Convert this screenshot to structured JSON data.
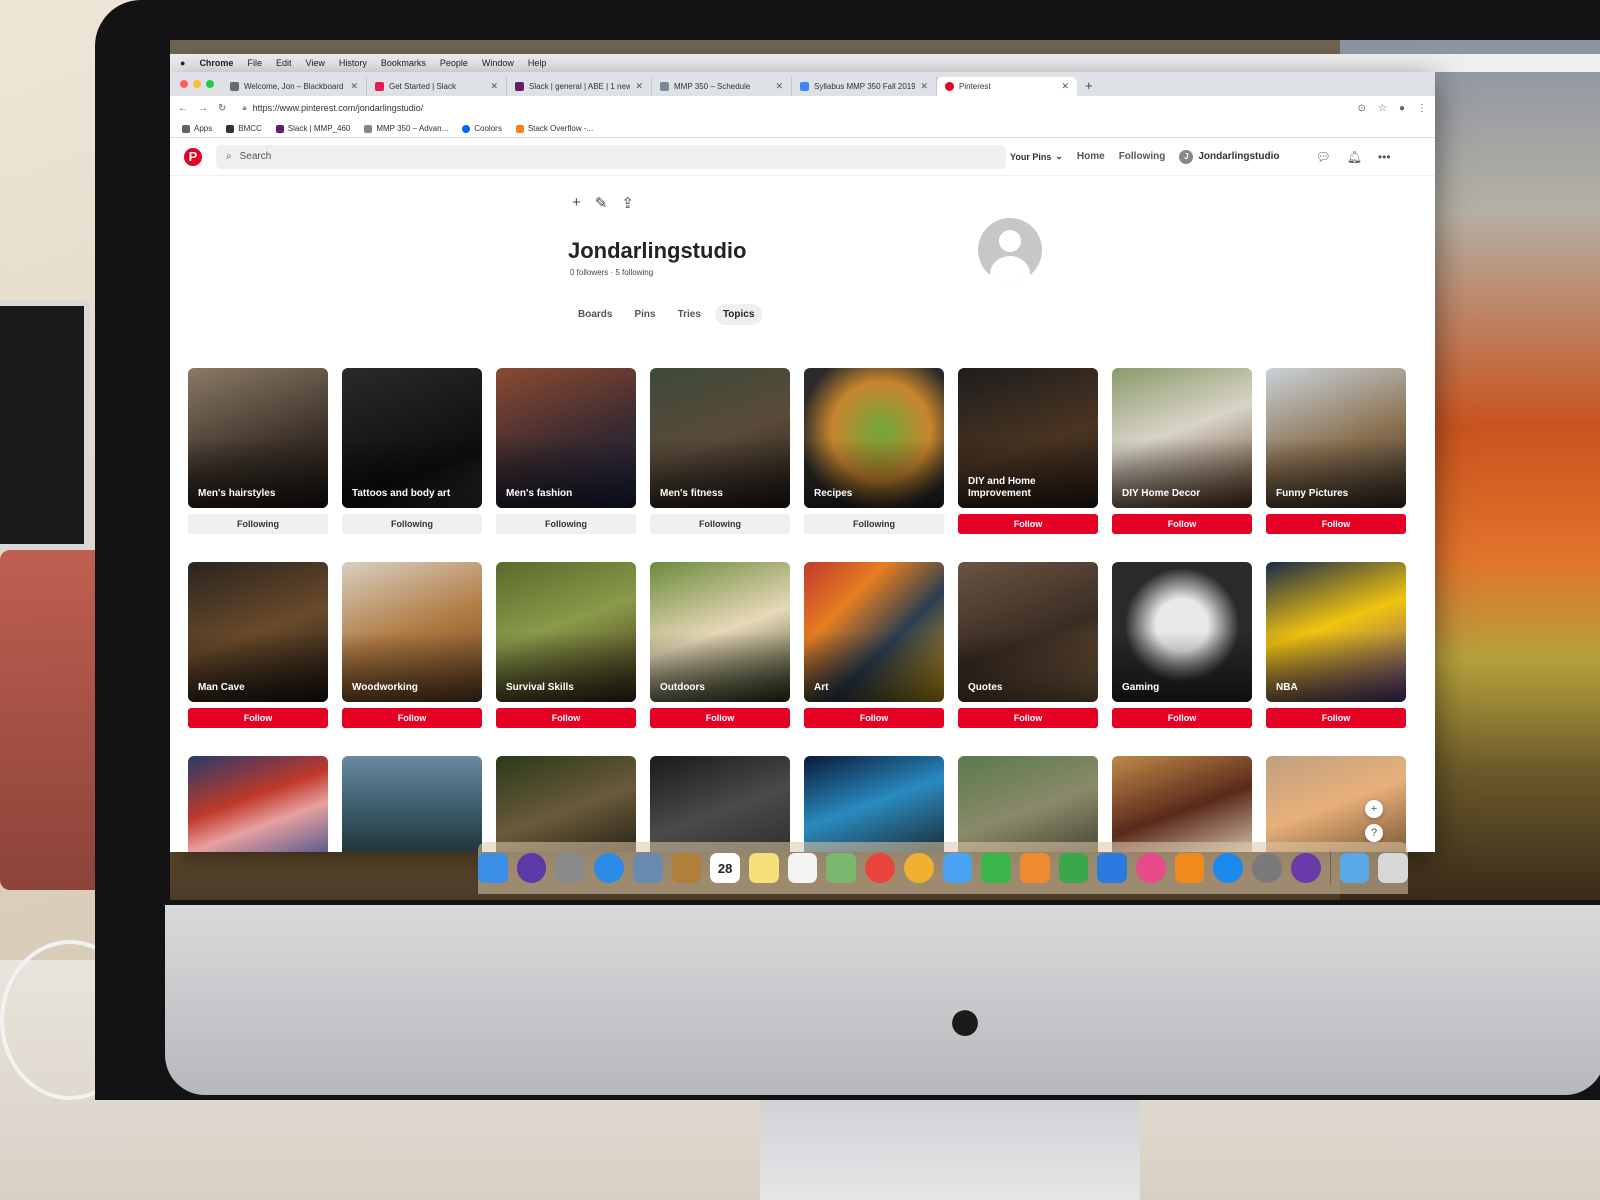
{
  "mac_menubar": {
    "apple": "",
    "items": [
      "Chrome",
      "File",
      "Edit",
      "View",
      "History",
      "Bookmarks",
      "People",
      "Window",
      "Help"
    ]
  },
  "browser": {
    "tabs": [
      {
        "label": "Welcome, Jon – Blackboard Le",
        "icon": "blackboard-icon",
        "color": "#6b6b6b"
      },
      {
        "label": "Get Started | Slack",
        "icon": "slack-icon",
        "color": "#e01e5a"
      },
      {
        "label": "Slack | general | ABE | 1 new it",
        "icon": "slack-icon",
        "color": "#611f69"
      },
      {
        "label": "MMP 350 – Schedule",
        "icon": "page-icon",
        "color": "#7a8a9a"
      },
      {
        "label": "Syllabus MMP 350 Fall 2019 -",
        "icon": "docs-icon",
        "color": "#4285f4"
      },
      {
        "label": "Pinterest",
        "icon": "pinterest-icon",
        "color": "#e60023"
      }
    ],
    "new_tab": "+",
    "url": "https://www.pinterest.com/jondarlingstudio/",
    "bookmarks": [
      {
        "label": "Apps",
        "color": "#5f6368"
      },
      {
        "label": "BMCC",
        "color": "#333333"
      },
      {
        "label": "Slack | MMP_460",
        "color": "#611f69"
      },
      {
        "label": "MMP 350 – Advan...",
        "color": "#7a8a9a"
      },
      {
        "label": "Coolors",
        "color": "#0066ff"
      },
      {
        "label": "Stack Overflow -...",
        "color": "#f48024"
      }
    ]
  },
  "pinterest": {
    "logo": "P",
    "search_placeholder": "Search",
    "your_pins": "Your Pins",
    "nav": {
      "home": "Home",
      "following": "Following",
      "username": "Jondarlingstudio",
      "avatar_letter": "J"
    },
    "profile": {
      "name": "Jondarlingstudio",
      "stats": "0 followers · 5 following",
      "tabs": [
        "Boards",
        "Pins",
        "Tries",
        "Topics"
      ],
      "active_tab": "Topics"
    },
    "topics_row1": [
      {
        "title": "Men's hairstyles",
        "button": "Following",
        "bg": "linear-gradient(160deg,#8a7a66,#3b3028 60%,#1d1713)"
      },
      {
        "title": "Tattoos and body art",
        "button": "Following",
        "bg": "linear-gradient(160deg,#2a2a2a,#0d0d0d 70%,#3a3a3a)"
      },
      {
        "title": "Men's fashion",
        "button": "Following",
        "bg": "linear-gradient(160deg,#8b4a32,#3a2a30 55%,#1a2340)"
      },
      {
        "title": "Men's fitness",
        "button": "Following",
        "bg": "linear-gradient(160deg,#3c4a38,#5a4a3a 50%,#201a14)"
      },
      {
        "title": "Recipes",
        "button": "Following",
        "bg": "radial-gradient(circle at 55% 45%,#6ea83a,#c8862e 45%,#2a2a2a 75%)"
      },
      {
        "title": "DIY and Home Improvement",
        "button": "Follow",
        "bg": "linear-gradient(160deg,#1d1d1d,#4a3422 55%,#2a1f18)"
      },
      {
        "title": "DIY Home Decor",
        "button": "Follow",
        "bg": "linear-gradient(160deg,#8a9a6a,#d9d4c8 45%,#5a3a24)"
      },
      {
        "title": "Funny Pictures",
        "button": "Follow",
        "bg": "linear-gradient(160deg,#c9d2d8,#8a7050 55%,#3a3028)"
      }
    ],
    "topics_row2": [
      {
        "title": "Man Cave",
        "button": "Follow",
        "bg": "linear-gradient(160deg,#2a2420,#6a4a2a 50%,#1a1612)"
      },
      {
        "title": "Woodworking",
        "button": "Follow",
        "bg": "linear-gradient(160deg,#d8cfc0,#b07a42 50%,#6a4424)"
      },
      {
        "title": "Survival Skills",
        "button": "Follow",
        "bg": "linear-gradient(160deg,#5a6a2a,#8a9a4a 45%,#3a2a18)"
      },
      {
        "title": "Outdoors",
        "button": "Follow",
        "bg": "linear-gradient(160deg,#6a8a3a,#e8d8b8 50%,#2a3a1a)"
      },
      {
        "title": "Art",
        "button": "Follow",
        "bg": "linear-gradient(135deg,#c0392b,#e67e22 30%,#2c3e50 60%,#d4a017)"
      },
      {
        "title": "Quotes",
        "button": "Follow",
        "bg": "linear-gradient(160deg,#6a5444,#3a2c22 55%,#8a6a4a)"
      },
      {
        "title": "Gaming",
        "button": "Follow",
        "bg": "radial-gradient(circle at 50% 45%,#e8e8e8 25%,#2a2a2a 55%)"
      },
      {
        "title": "NBA",
        "button": "Follow",
        "bg": "linear-gradient(160deg,#1a2a4a,#f1c40f 45%,#5a3a8a)"
      }
    ],
    "topics_row3": [
      {
        "bg": "linear-gradient(160deg,#2a3a6a,#c0392b 40%,#e8a0a0 60%,#3a4a8a)"
      },
      {
        "bg": "linear-gradient(180deg,#6a8aa0,#3a5a6a 50%,#1a2a2a)"
      },
      {
        "bg": "linear-gradient(160deg,#2a3a1a,#6a5a3a 50%,#1a1a10)"
      },
      {
        "bg": "linear-gradient(160deg,#1a1a1a,#4a4a4a 50%,#2a2a2a)"
      },
      {
        "bg": "linear-gradient(160deg,#0a1a3a,#2a8ac0 45%,#1a1a1a)"
      },
      {
        "bg": "linear-gradient(160deg,#5a7a4a,#8a8a6a 50%,#3a3a2a)"
      },
      {
        "bg": "linear-gradient(160deg,#c08a4a,#5a2a1a 50%,#e8d8c8)"
      },
      {
        "bg": "linear-gradient(160deg,#c0a080,#e8b07a 45%,#6a4a2a)"
      }
    ],
    "fab_plus": "+",
    "fab_help": "?"
  },
  "dock": {
    "calendar_day": "28",
    "apps": [
      {
        "name": "finder-icon",
        "color": "#3a8ee6",
        "glyph": ""
      },
      {
        "name": "siri-icon",
        "color": "#5b3aa8",
        "glyph": ""
      },
      {
        "name": "launchpad-icon",
        "color": "#8a8a8a",
        "glyph": ""
      },
      {
        "name": "safari-icon",
        "color": "#2a8ae6",
        "glyph": ""
      },
      {
        "name": "preview-icon",
        "color": "#6a8ab0",
        "glyph": ""
      },
      {
        "name": "notes-brown-icon",
        "color": "#b0803a",
        "glyph": ""
      },
      {
        "name": "calendar-icon",
        "color": "#ffffff",
        "glyph": "28"
      },
      {
        "name": "notes-icon",
        "color": "#f5e07a",
        "glyph": ""
      },
      {
        "name": "reminders-icon",
        "color": "#f4f4f4",
        "glyph": ""
      },
      {
        "name": "maps-icon",
        "color": "#7ab870",
        "glyph": ""
      },
      {
        "name": "chrome-icon",
        "color": "#e8453c",
        "glyph": ""
      },
      {
        "name": "photos-icon",
        "color": "#f0b030",
        "glyph": ""
      },
      {
        "name": "messages-icon",
        "color": "#4aa3f0",
        "glyph": ""
      },
      {
        "name": "facetime-icon",
        "color": "#3ab54a",
        "glyph": ""
      },
      {
        "name": "pages-icon",
        "color": "#f08a30",
        "glyph": ""
      },
      {
        "name": "numbers-icon",
        "color": "#3aa84a",
        "glyph": ""
      },
      {
        "name": "keynote-icon",
        "color": "#2a7ae0",
        "glyph": ""
      },
      {
        "name": "itunes-icon",
        "color": "#e84a8a",
        "glyph": ""
      },
      {
        "name": "books-icon",
        "color": "#f08a1a",
        "glyph": ""
      },
      {
        "name": "app-store-icon",
        "color": "#1a8af0",
        "glyph": ""
      },
      {
        "name": "system-preferences-icon",
        "color": "#7a7a7a",
        "glyph": ""
      },
      {
        "name": "github-desktop-icon",
        "color": "#6a3aa8",
        "glyph": ""
      },
      {
        "name": "downloads-folder-icon",
        "color": "#5aa8e8",
        "glyph": ""
      },
      {
        "name": "trash-icon",
        "color": "#d8d8d8",
        "glyph": ""
      }
    ]
  }
}
